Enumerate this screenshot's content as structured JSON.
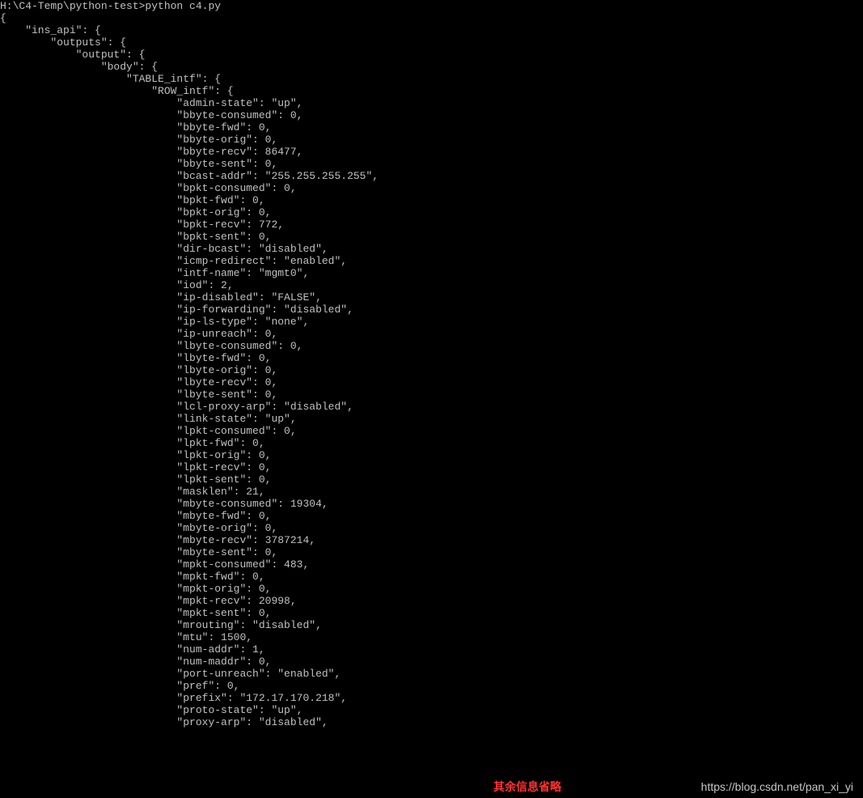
{
  "prompt": "H:\\C4-Temp\\python-test>python c4.py",
  "json_tree": {
    "ins_api": {
      "outputs": {
        "output": {
          "body": {
            "TABLE_intf": {
              "ROW_intf": {
                "admin-state": "up",
                "bbyte-consumed": 0,
                "bbyte-fwd": 0,
                "bbyte-orig": 0,
                "bbyte-recv": 86477,
                "bbyte-sent": 0,
                "bcast-addr": "255.255.255.255",
                "bpkt-consumed": 0,
                "bpkt-fwd": 0,
                "bpkt-orig": 0,
                "bpkt-recv": 772,
                "bpkt-sent": 0,
                "dir-bcast": "disabled",
                "icmp-redirect": "enabled",
                "intf-name": "mgmt0",
                "iod": 2,
                "ip-disabled": "FALSE",
                "ip-forwarding": "disabled",
                "ip-ls-type": "none",
                "ip-unreach": 0,
                "lbyte-consumed": 0,
                "lbyte-fwd": 0,
                "lbyte-orig": 0,
                "lbyte-recv": 0,
                "lbyte-sent": 0,
                "lcl-proxy-arp": "disabled",
                "link-state": "up",
                "lpkt-consumed": 0,
                "lpkt-fwd": 0,
                "lpkt-orig": 0,
                "lpkt-recv": 0,
                "lpkt-sent": 0,
                "masklen": 21,
                "mbyte-consumed": 19304,
                "mbyte-fwd": 0,
                "mbyte-orig": 0,
                "mbyte-recv": 3787214,
                "mbyte-sent": 0,
                "mpkt-consumed": 483,
                "mpkt-fwd": 0,
                "mpkt-orig": 0,
                "mpkt-recv": 20998,
                "mpkt-sent": 0,
                "mrouting": "disabled",
                "mtu": 1500,
                "num-addr": 1,
                "num-maddr": 0,
                "port-unreach": "enabled",
                "pref": 0,
                "prefix": "172.17.170.218",
                "proto-state": "up",
                "proxy-arp": "disabled"
              }
            }
          }
        }
      }
    }
  },
  "note": "其余信息省略",
  "watermark": "https://blog.csdn.net/pan_xi_yi",
  "terminal_text": "H:\\C4-Temp\\python-test>python c4.py\n{\n    \"ins_api\": {\n        \"outputs\": {\n            \"output\": {\n                \"body\": {\n                    \"TABLE_intf\": {\n                        \"ROW_intf\": {\n                            \"admin-state\": \"up\",\n                            \"bbyte-consumed\": 0,\n                            \"bbyte-fwd\": 0,\n                            \"bbyte-orig\": 0,\n                            \"bbyte-recv\": 86477,\n                            \"bbyte-sent\": 0,\n                            \"bcast-addr\": \"255.255.255.255\",\n                            \"bpkt-consumed\": 0,\n                            \"bpkt-fwd\": 0,\n                            \"bpkt-orig\": 0,\n                            \"bpkt-recv\": 772,\n                            \"bpkt-sent\": 0,\n                            \"dir-bcast\": \"disabled\",\n                            \"icmp-redirect\": \"enabled\",\n                            \"intf-name\": \"mgmt0\",\n                            \"iod\": 2,\n                            \"ip-disabled\": \"FALSE\",\n                            \"ip-forwarding\": \"disabled\",\n                            \"ip-ls-type\": \"none\",\n                            \"ip-unreach\": 0,\n                            \"lbyte-consumed\": 0,\n                            \"lbyte-fwd\": 0,\n                            \"lbyte-orig\": 0,\n                            \"lbyte-recv\": 0,\n                            \"lbyte-sent\": 0,\n                            \"lcl-proxy-arp\": \"disabled\",\n                            \"link-state\": \"up\",\n                            \"lpkt-consumed\": 0,\n                            \"lpkt-fwd\": 0,\n                            \"lpkt-orig\": 0,\n                            \"lpkt-recv\": 0,\n                            \"lpkt-sent\": 0,\n                            \"masklen\": 21,\n                            \"mbyte-consumed\": 19304,\n                            \"mbyte-fwd\": 0,\n                            \"mbyte-orig\": 0,\n                            \"mbyte-recv\": 3787214,\n                            \"mbyte-sent\": 0,\n                            \"mpkt-consumed\": 483,\n                            \"mpkt-fwd\": 0,\n                            \"mpkt-orig\": 0,\n                            \"mpkt-recv\": 20998,\n                            \"mpkt-sent\": 0,\n                            \"mrouting\": \"disabled\",\n                            \"mtu\": 1500,\n                            \"num-addr\": 1,\n                            \"num-maddr\": 0,\n                            \"port-unreach\": \"enabled\",\n                            \"pref\": 0,\n                            \"prefix\": \"172.17.170.218\",\n                            \"proto-state\": \"up\",\n                            \"proxy-arp\": \"disabled\","
}
